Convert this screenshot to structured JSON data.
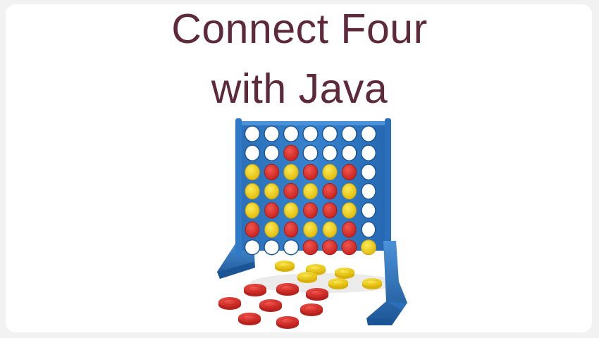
{
  "header": {
    "title_line_1": "Connect Four",
    "title_line_2": "with Java"
  },
  "image": {
    "subject": "connect-four-game-board-icon",
    "colors": {
      "frame": "#2e78c4",
      "frame_dark": "#1c5596",
      "frame_light": "#4b92d8",
      "red_disc": "#d9302b",
      "red_disc_light": "#f1564d",
      "yellow_disc": "#f2d21c",
      "yellow_disc_light": "#fbea55",
      "empty_hole": "#ffffff",
      "title_text": "#5e2a39"
    },
    "board": {
      "columns": 7,
      "rows": 6,
      "cells": [
        [
          "E",
          "E",
          "E",
          "E",
          "E",
          "E",
          "E"
        ],
        [
          "E",
          "E",
          "R",
          "E",
          "E",
          "E",
          "E"
        ],
        [
          "Y",
          "R",
          "Y",
          "R",
          "Y",
          "R",
          "E"
        ],
        [
          "Y",
          "Y",
          "R",
          "Y",
          "R",
          "Y",
          "E"
        ],
        [
          "Y",
          "R",
          "Y",
          "R",
          "R",
          "Y",
          "E"
        ],
        [
          "R",
          "Y",
          "R",
          "Y",
          "Y",
          "R",
          "E"
        ]
      ],
      "front_row": [
        "E",
        "E",
        "E",
        "R",
        "R",
        "R",
        "Y"
      ]
    }
  }
}
